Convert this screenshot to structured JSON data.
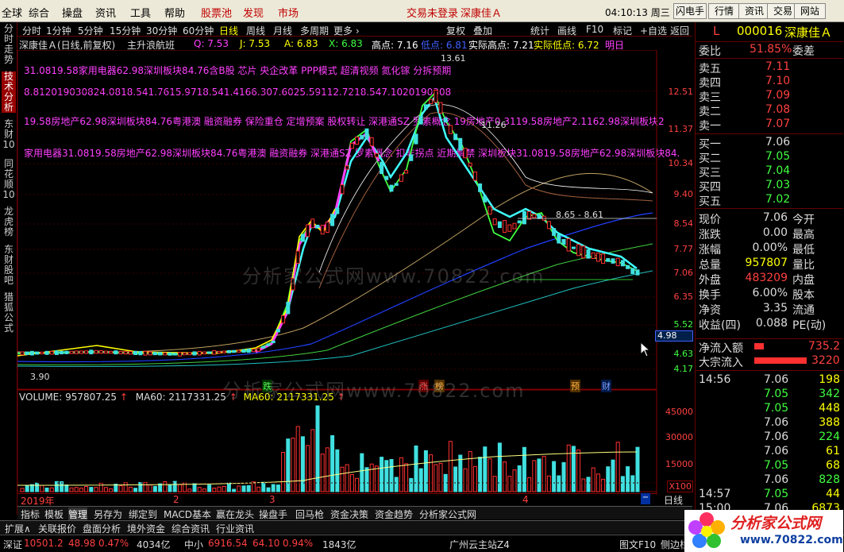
{
  "top_menu": {
    "items": [
      "全球",
      "综合",
      "操盘",
      "资讯",
      "工具",
      "帮助",
      "股票池",
      "发现",
      "市场"
    ],
    "status_text": "交易未登录",
    "stock_title": "深康佳Ａ",
    "time": "04:10:13 周三",
    "buttons": [
      "闪电手",
      "行情",
      "资讯",
      "交易",
      "网站"
    ]
  },
  "left_tabs": [
    "分时走势",
    "技术分析",
    "东财10",
    "同花顺10",
    "龙虎榜",
    "东财股吧",
    "猎狐公式"
  ],
  "toolbar": {
    "items": [
      "分时",
      "1分钟",
      "5分钟",
      "15分钟",
      "30分钟",
      "60分钟",
      "日线",
      "周线",
      "月线",
      "多周期",
      "更多 ›"
    ],
    "right_items": [
      "复权",
      "叠加",
      "统计",
      "画线",
      "F10",
      "标记",
      "+自选",
      "返回"
    ]
  },
  "infobar": {
    "stock": "深康佳Ａ(日线,前复权)",
    "indicator": "主升浪航班",
    "q": "Q: 7.53",
    "j": "J: 7.53",
    "a": "A: 6.83",
    "x": "X: 6.83",
    "high_point": "高点: 7.16",
    "low_point": "低点: 6.81",
    "actual_high": "实际高点: 7.21",
    "actual_low": "实际低点: 6.72",
    "tomorrow": "明日"
  },
  "annotations": [
    "31.0819.58家用电器62.98深圳板块84.76含B股 芯片 央企改革 PPP模式 超清视频 氮化镓 分拆预期",
    "8.812019030824.0818.541.7615.9718.541.4166.307.6025.59112.7218.547.1020190308",
    "19.58房地产62.98深圳板块84.76粤港澳 融资融券 保险重仓 定增预案 股权转让 深港通SZ 罗素概念 19房地产0.3119.58房地产2.1162.98深圳板块2",
    "家用电器31.0819.58房地产62.98深圳板块84.76粤港澳 融资融券 深港通SZ 罗素概念 扣非拐点 近期解禁 深圳板块31.0819.58房地产62.98深圳板块84."
  ],
  "price_axis": [
    "12.51",
    "11.37",
    "10.34",
    "9.40",
    "8.54",
    "7.77",
    "7.06",
    "6.35",
    "5.52",
    "4.63",
    "4.17"
  ],
  "price_current_box": "4.98",
  "peak_label": "13.61",
  "sub_peak_label": "11.26",
  "mid_label": "8.65 - 8.61",
  "low_label": "3.90",
  "event_tags": [
    "跌",
    "涨",
    "榜",
    "预",
    "财"
  ],
  "volume_header": {
    "volume": "VOLUME: 957807.25",
    "ma60": "MA60: 2117331.25",
    "ma60b": "MA60: 2117331.25"
  },
  "volume_axis": [
    "45000",
    "30000",
    "15000"
  ],
  "volume_unit": "X100",
  "time_axis": [
    "2019年",
    "2",
    "3",
    "4"
  ],
  "period_label": "日线",
  "bottom_tabs": [
    "指标",
    "模板",
    "管理",
    "另存为",
    "绑定到",
    "MACD基本",
    "赢在龙头",
    "操盘手",
    "回马枪",
    "资金决策",
    "资金趋势",
    "分析家公式网"
  ],
  "bottom_tabs2": [
    "扩展∧",
    "关联报价",
    "盘面分析",
    "境外资金",
    "综合资讯",
    "行业资讯"
  ],
  "quote": {
    "prefix": "L",
    "code": "000016",
    "name": "深康佳Ａ",
    "weibi_label": "委比",
    "weibi_value": "51.85%",
    "weicha_label": "委差",
    "asks": [
      {
        "label": "卖五",
        "price": "7.11"
      },
      {
        "label": "卖四",
        "price": "7.10"
      },
      {
        "label": "卖三",
        "price": "7.09"
      },
      {
        "label": "卖二",
        "price": "7.08"
      },
      {
        "label": "卖一",
        "price": "7.07"
      }
    ],
    "bids": [
      {
        "label": "买一",
        "price": "7.06"
      },
      {
        "label": "买二",
        "price": "7.05"
      },
      {
        "label": "买三",
        "price": "7.04"
      },
      {
        "label": "买四",
        "price": "7.03"
      },
      {
        "label": "买五",
        "price": "7.02"
      }
    ],
    "stats": [
      {
        "l": "现价",
        "v": "7.06",
        "l2": "今开"
      },
      {
        "l": "涨跌",
        "v": "0.00",
        "l2": "最高"
      },
      {
        "l": "涨幅",
        "v": "0.00%",
        "l2": "最低"
      },
      {
        "l": "总量",
        "v": "957807",
        "l2": "量比"
      },
      {
        "l": "外盘",
        "v": "483209",
        "l2": "内盘"
      },
      {
        "l": "换手",
        "v": "6.00%",
        "l2": "股本"
      },
      {
        "l": "净资",
        "v": "3.35",
        "l2": "流通"
      },
      {
        "l": "收益(四)",
        "v": "0.088",
        "l2": "PE(动)"
      }
    ],
    "net_inflow_label": "净流入额",
    "net_inflow_value": "735.2",
    "big_inflow_label": "大宗流入",
    "big_inflow_value": "3220",
    "ticks": [
      {
        "t": "14:56",
        "p": "7.06",
        "v": "198"
      },
      {
        "t": "",
        "p": "7.05",
        "v": "342"
      },
      {
        "t": "",
        "p": "7.05",
        "v": "448"
      },
      {
        "t": "",
        "p": "7.06",
        "v": "388"
      },
      {
        "t": "",
        "p": "7.06",
        "v": "224"
      },
      {
        "t": "",
        "p": "7.06",
        "v": "61"
      },
      {
        "t": "",
        "p": "7.05",
        "v": "68"
      },
      {
        "t": "",
        "p": "7.06",
        "v": "828"
      },
      {
        "t": "14:57",
        "p": "7.05",
        "v": "44"
      },
      {
        "t": "15:00",
        "p": "7.06",
        "v": "6873"
      }
    ]
  },
  "status_bar": {
    "sz_label": "深证",
    "sz_value": "10501.2",
    "sz_change": "48.98",
    "sz_pct": "0.47%",
    "sz_amount": "4034亿",
    "zx_label": "中小",
    "zx_value": "6916.54",
    "zx_change": "64.10",
    "zx_pct": "0.94%",
    "zx_amount": "1843亿",
    "server": "广州云主站Z4",
    "right1": "图文F10",
    "right2": "侧边栏"
  },
  "watermark": "分析家公式网www.70822.com",
  "logo_text": "分析家公式网",
  "logo_url": "www.70822.com",
  "colors": {
    "up": "#ff3030",
    "down": "#40e0e0",
    "yellow": "#ffff00",
    "magenta": "#ff40ff"
  }
}
